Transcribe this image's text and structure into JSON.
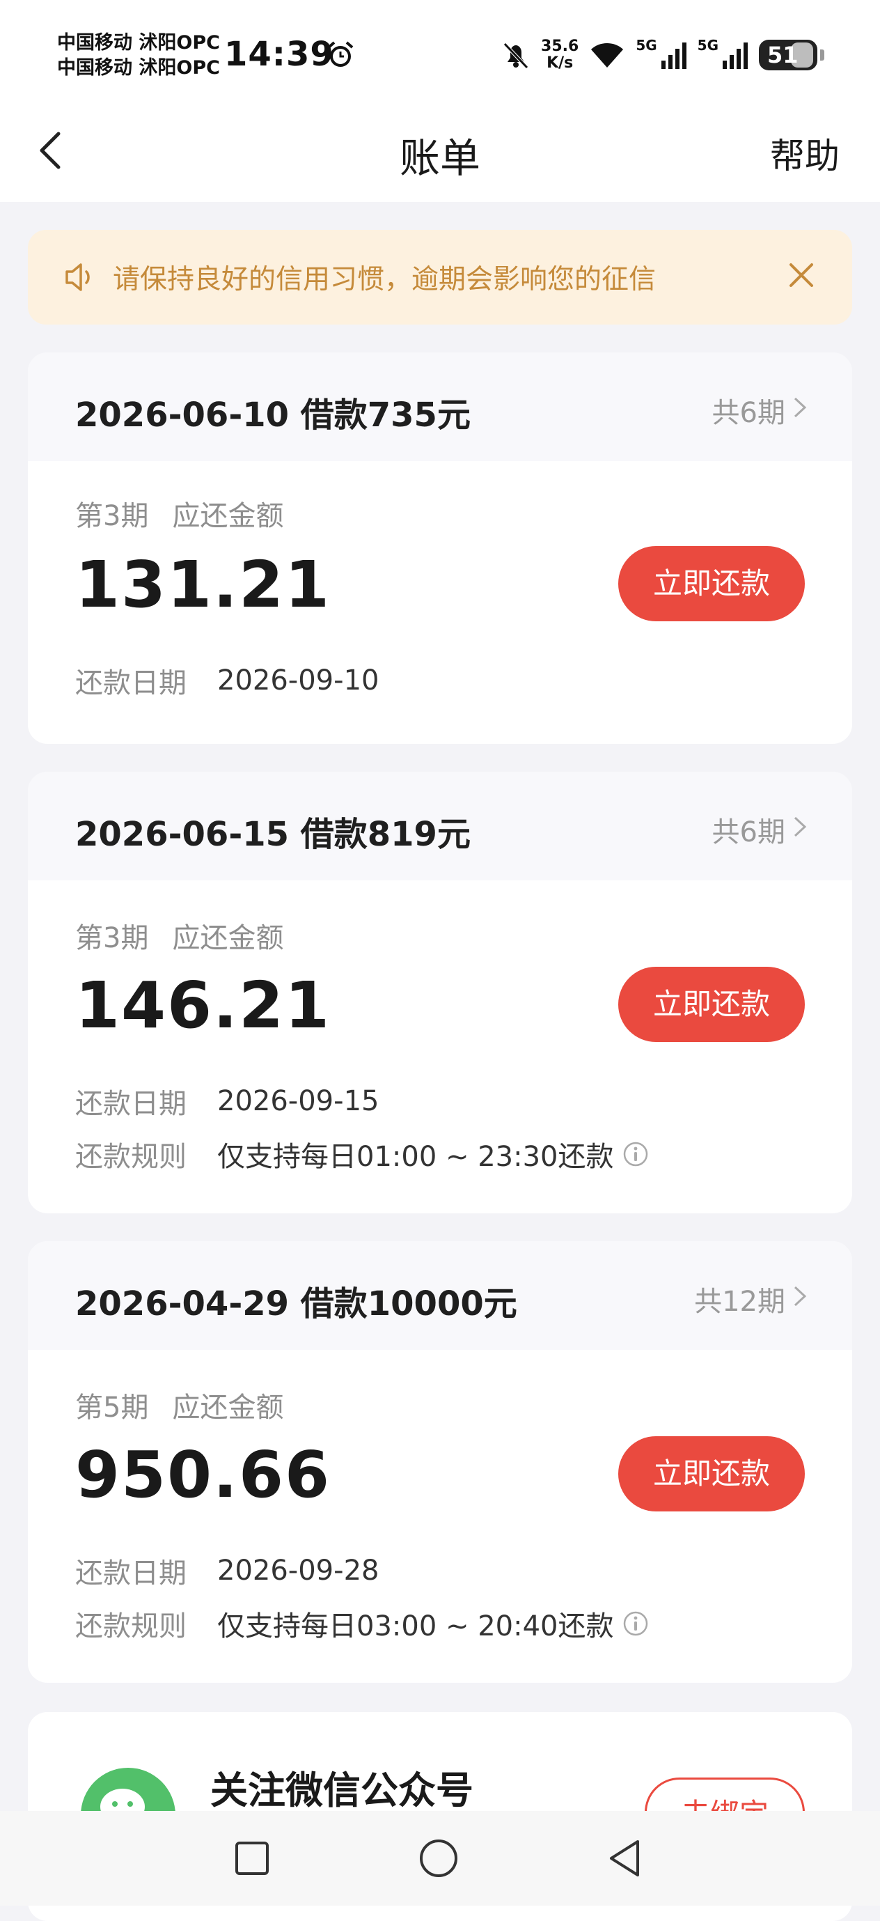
{
  "status_bar": {
    "carrier_line1": "中国移动 沭阳OPC",
    "carrier_line2": "中国移动 沭阳OPC",
    "time": "14:39",
    "net_speed_value": "35.6",
    "net_speed_unit": "K/s",
    "sim1_label": "5G",
    "sim2_label": "5G",
    "battery": "51",
    "icons": [
      "alarm-icon",
      "mute-bell-icon",
      "wifi-icon",
      "signal-icon",
      "signal-icon",
      "battery-icon"
    ]
  },
  "header": {
    "title": "账单",
    "help": "帮助",
    "back_icon": "chevron-left-icon"
  },
  "notice": {
    "text": "请保持良好的信用习惯，逾期会影响您的征信",
    "icons": [
      "speaker-icon",
      "close-icon"
    ]
  },
  "bills": [
    {
      "loan": "2026-06-10 借款735元",
      "periods": "共6期",
      "installment": "第3期",
      "due_label": "应还金额",
      "amount": "131.21",
      "pay_button": "立即还款",
      "date_label": "还款日期",
      "date": "2026-09-10"
    },
    {
      "loan": "2026-06-15 借款819元",
      "periods": "共6期",
      "installment": "第3期",
      "due_label": "应还金额",
      "amount": "146.21",
      "pay_button": "立即还款",
      "date_label": "还款日期",
      "date": "2026-09-15",
      "rule_label": "还款规则",
      "rule": "仅支持每日01:00 ~ 23:30还款"
    },
    {
      "loan": "2026-04-29 借款10000元",
      "periods": "共12期",
      "installment": "第5期",
      "due_label": "应还金额",
      "amount": "950.66",
      "pay_button": "立即还款",
      "date_label": "还款日期",
      "date": "2026-09-28",
      "rule_label": "还款规则",
      "rule": "仅支持每日03:00 ~ 20:40还款"
    }
  ],
  "wechat": {
    "title": "关注微信公众号",
    "button": "去绑定"
  },
  "colors": {
    "accent": "#ea4a3f",
    "notice_bg": "#fdf1df",
    "notice_text": "#c58a3a",
    "page_bg": "#f3f3f7"
  },
  "navbar": {
    "icons": [
      "recent-apps-icon",
      "home-icon",
      "back-icon"
    ]
  }
}
